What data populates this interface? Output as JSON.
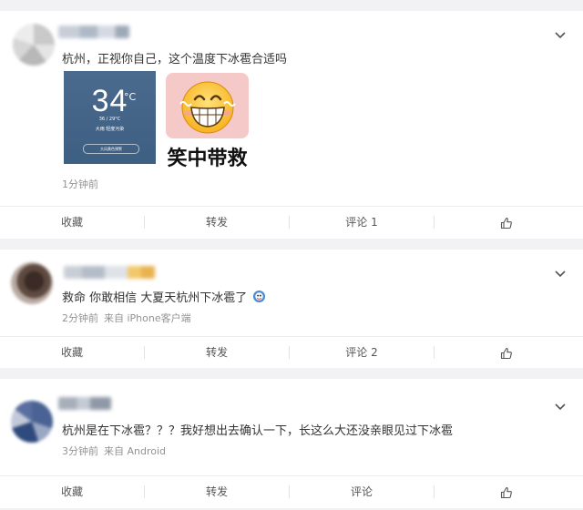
{
  "posts": [
    {
      "text": "杭州，正视你自己，这个温度下冰雹合适吗",
      "time": "1分钟前",
      "source": "",
      "weather_image": {
        "temp": "34",
        "unit": "°C",
        "range": "36 / 29°C",
        "condition": "大雨  轻度污染",
        "alert": "大风黄色预警"
      },
      "sticker_caption": "笑中带救",
      "actions": {
        "favorite": "收藏",
        "repost": "转发",
        "comment": "评论 1"
      }
    },
    {
      "text": "救命 你敢相信 大夏天杭州下冰雹了",
      "time": "2分钟前",
      "source": "来自 iPhone客户端",
      "actions": {
        "favorite": "收藏",
        "repost": "转发",
        "comment": "评论 2"
      }
    },
    {
      "text": "杭州是在下冰雹？？？我好想出去确认一下，长这么大还没亲眼见过下冰雹",
      "time": "3分钟前",
      "source": "来自 Android",
      "actions": {
        "favorite": "收藏",
        "repost": "转发",
        "comment": "评论"
      }
    }
  ],
  "colors": {
    "background": "#f2f2f5",
    "card": "#ffffff",
    "meta_text": "#939393",
    "divider": "#ececec"
  },
  "icons": [
    "chevron-down-icon",
    "thumbs-up-icon",
    "emoji-sticker-icon"
  ]
}
